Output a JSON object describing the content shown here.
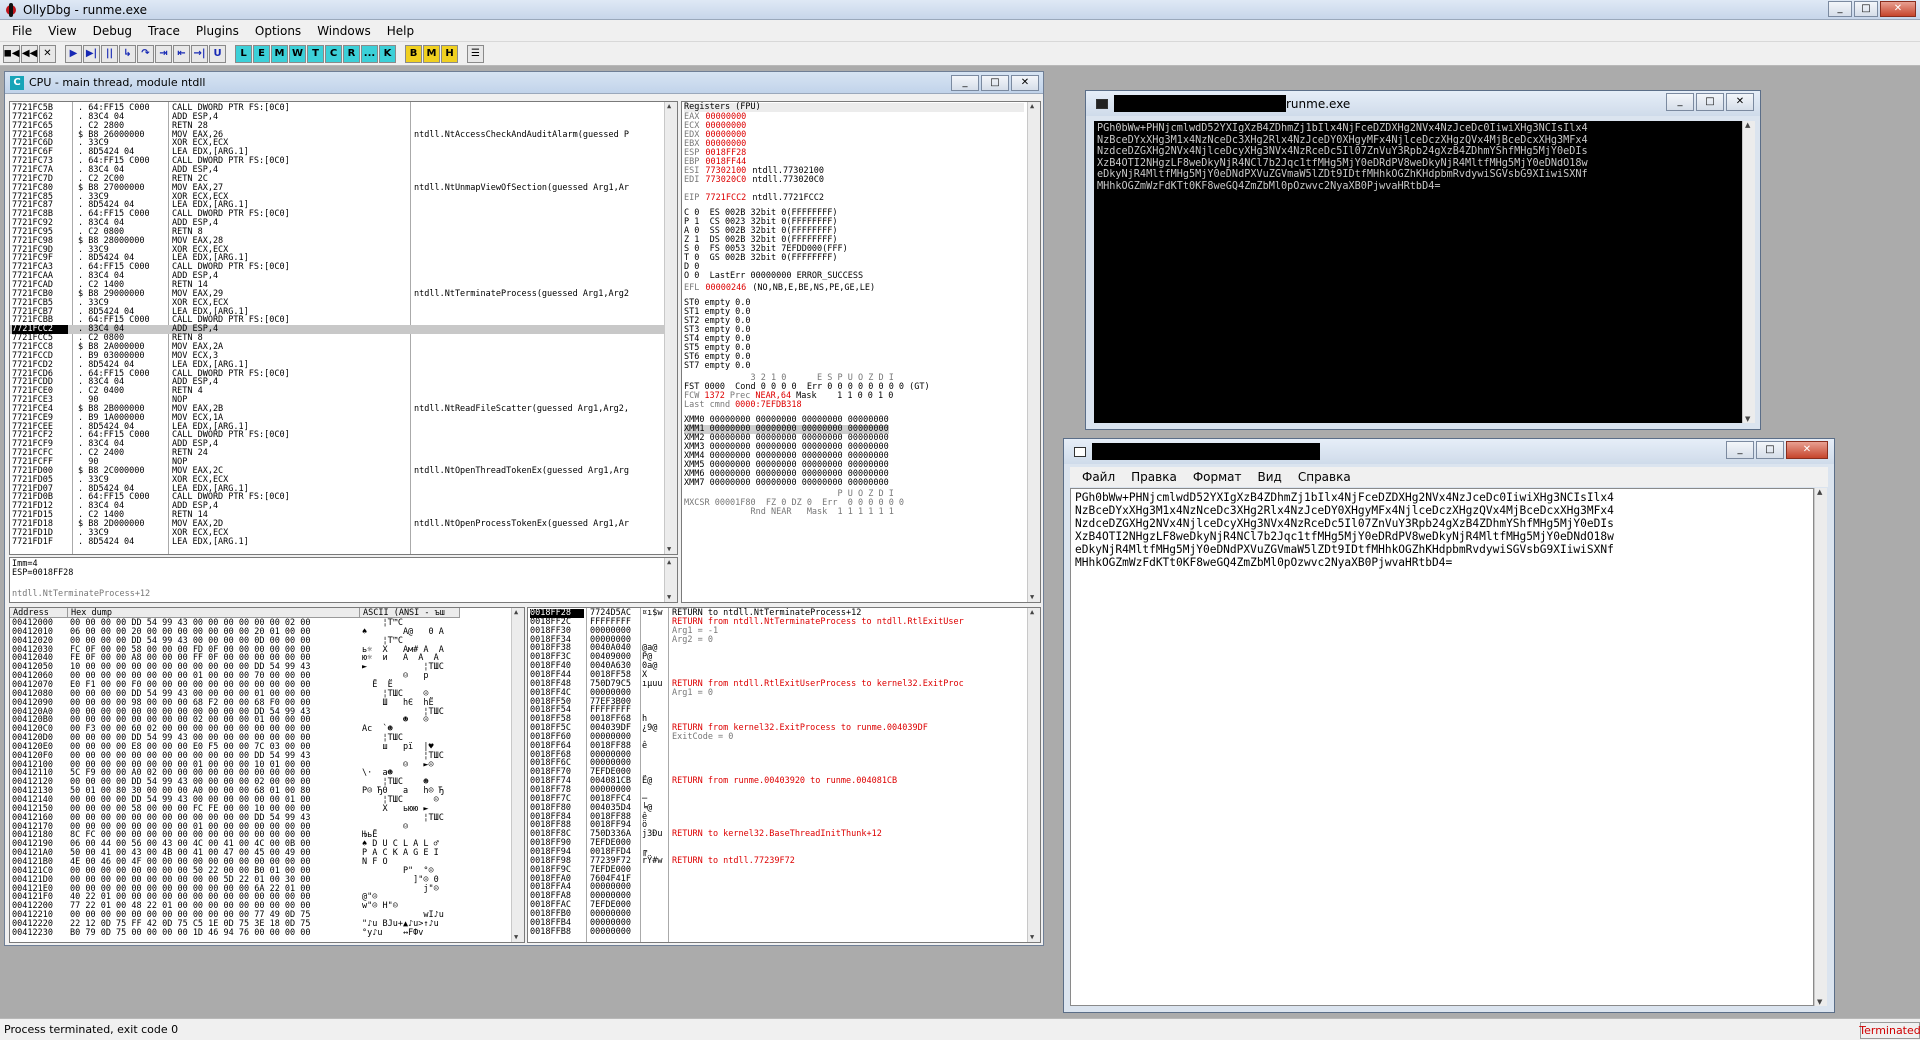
{
  "app": {
    "title": "OllyDbg - runme.exe",
    "minimize_label": "_",
    "maximize_label": "□",
    "close_label": "✕"
  },
  "menu": [
    "File",
    "View",
    "Debug",
    "Trace",
    "Plugins",
    "Options",
    "Windows",
    "Help"
  ],
  "toolbar": {
    "buttons": [
      "◼◀",
      "◀◀",
      "✕",
      "▶",
      "▶|",
      "||",
      "↳",
      "↷",
      "⇥",
      "⇤",
      "→|",
      "U",
      "L",
      "E",
      "M",
      "W",
      "T",
      "C",
      "R",
      "...",
      "K",
      "B",
      "M",
      "H",
      "☰"
    ],
    "styles": [
      "",
      "",
      "",
      "blue",
      "blue",
      "blue",
      "blue",
      "blue",
      "blue",
      "blue",
      "blue",
      "blue",
      "cyan",
      "cyan",
      "cyan",
      "cyan",
      "cyan",
      "cyan",
      "cyan",
      "cyan",
      "cyan",
      "yellow",
      "yellow",
      "yellow",
      ""
    ]
  },
  "cpu": {
    "title": "CPU - main thread, module ntdll",
    "icon_letter": "C",
    "disasm": [
      [
        "7721FC5B",
        ". 64:FF15 C000",
        "CALL DWORD PTR FS:[0C0]",
        ""
      ],
      [
        "7721FC62",
        ". 83C4 04",
        "ADD ESP,4",
        ""
      ],
      [
        "7721FC65",
        ". C2 2800",
        "RETN 28",
        ""
      ],
      [
        "7721FC68",
        "$ B8 26000000",
        "MOV EAX,26",
        "ntdll.NtAccessCheckAndAuditAlarm(guessed P"
      ],
      [
        "7721FC6D",
        ". 33C9",
        "XOR ECX,ECX",
        ""
      ],
      [
        "7721FC6F",
        ". 8D5424 04",
        "LEA EDX,[ARG.1]",
        ""
      ],
      [
        "7721FC73",
        ". 64:FF15 C000",
        "CALL DWORD PTR FS:[0C0]",
        ""
      ],
      [
        "7721FC7A",
        ". 83C4 04",
        "ADD ESP,4",
        ""
      ],
      [
        "7721FC7D",
        ". C2 2C00",
        "RETN 2C",
        ""
      ],
      [
        "7721FC80",
        "$ B8 27000000",
        "MOV EAX,27",
        "ntdll.NtUnmapViewOfSection(guessed Arg1,Ar"
      ],
      [
        "7721FC85",
        ". 33C9",
        "XOR ECX,ECX",
        ""
      ],
      [
        "7721FC87",
        ". 8D5424 04",
        "LEA EDX,[ARG.1]",
        ""
      ],
      [
        "7721FC8B",
        ". 64:FF15 C000",
        "CALL DWORD PTR FS:[0C0]",
        ""
      ],
      [
        "7721FC92",
        ". 83C4 04",
        "ADD ESP,4",
        ""
      ],
      [
        "7721FC95",
        ". C2 0800",
        "RETN 8",
        ""
      ],
      [
        "7721FC98",
        "$ B8 28000000",
        "MOV EAX,28",
        ""
      ],
      [
        "7721FC9D",
        ". 33C9",
        "XOR ECX,ECX",
        ""
      ],
      [
        "7721FC9F",
        ". 8D5424 04",
        "LEA EDX,[ARG.1]",
        ""
      ],
      [
        "7721FCA3",
        ". 64:FF15 C000",
        "CALL DWORD PTR FS:[0C0]",
        ""
      ],
      [
        "7721FCAA",
        ". 83C4 04",
        "ADD ESP,4",
        ""
      ],
      [
        "7721FCAD",
        ". C2 1400",
        "RETN 14",
        ""
      ],
      [
        "7721FCB0",
        "$ B8 29000000",
        "MOV EAX,29",
        "ntdll.NtTerminateProcess(guessed Arg1,Arg2"
      ],
      [
        "7721FCB5",
        ". 33C9",
        "XOR ECX,ECX",
        ""
      ],
      [
        "7721FCB7",
        ". 8D5424 04",
        "LEA EDX,[ARG.1]",
        ""
      ],
      [
        "7721FCBB",
        ". 64:FF15 C000",
        "CALL DWORD PTR FS:[0C0]",
        ""
      ],
      [
        "7721FCC2",
        ". 83C4 04",
        "ADD ESP,4",
        ""
      ],
      [
        "7721FCC5",
        ". C2 0800",
        "RETN 8",
        ""
      ],
      [
        "7721FCC8",
        "$ B8 2A000000",
        "MOV EAX,2A",
        ""
      ],
      [
        "7721FCCD",
        ". B9 03000000",
        "MOV ECX,3",
        ""
      ],
      [
        "7721FCD2",
        ". 8D5424 04",
        "LEA EDX,[ARG.1]",
        ""
      ],
      [
        "7721FCD6",
        ". 64:FF15 C000",
        "CALL DWORD PTR FS:[0C0]",
        ""
      ],
      [
        "7721FCDD",
        ". 83C4 04",
        "ADD ESP,4",
        ""
      ],
      [
        "7721FCE0",
        ". C2 0400",
        "RETN 4",
        ""
      ],
      [
        "7721FCE3",
        "  90",
        "NOP",
        ""
      ],
      [
        "7721FCE4",
        "$ B8 2B000000",
        "MOV EAX,2B",
        "ntdll.NtReadFileScatter(guessed Arg1,Arg2,"
      ],
      [
        "7721FCE9",
        ". B9 1A000000",
        "MOV ECX,1A",
        ""
      ],
      [
        "7721FCEE",
        ". 8D5424 04",
        "LEA EDX,[ARG.1]",
        ""
      ],
      [
        "7721FCF2",
        ". 64:FF15 C000",
        "CALL DWORD PTR FS:[0C0]",
        ""
      ],
      [
        "7721FCF9",
        ". 83C4 04",
        "ADD ESP,4",
        ""
      ],
      [
        "7721FCFC",
        ". C2 2400",
        "RETN 24",
        ""
      ],
      [
        "7721FCFF",
        "  90",
        "NOP",
        ""
      ],
      [
        "7721FD00",
        "$ B8 2C000000",
        "MOV EAX,2C",
        "ntdll.NtOpenThreadTokenEx(guessed Arg1,Arg"
      ],
      [
        "7721FD05",
        ". 33C9",
        "XOR ECX,ECX",
        ""
      ],
      [
        "7721FD07",
        ". 8D5424 04",
        "LEA EDX,[ARG.1]",
        ""
      ],
      [
        "7721FD0B",
        ". 64:FF15 C000",
        "CALL DWORD PTR FS:[0C0]",
        ""
      ],
      [
        "7721FD12",
        ". 83C4 04",
        "ADD ESP,4",
        ""
      ],
      [
        "7721FD15",
        ". C2 1400",
        "RETN 14",
        ""
      ],
      [
        "7721FD18",
        "$ B8 2D000000",
        "MOV EAX,2D",
        "ntdll.NtOpenProcessTokenEx(guessed Arg1,Ar"
      ],
      [
        "7721FD1D",
        ". 33C9",
        "XOR ECX,ECX",
        ""
      ],
      [
        "7721FD1F",
        ". 8D5424 04",
        "LEA EDX,[ARG.1]",
        ""
      ]
    ],
    "selected_row": 25,
    "info": [
      "Imm=4",
      "ESP=0018FF28",
      "",
      "",
      "ntdll.NtTerminateProcess+12"
    ],
    "registers_header": "Registers (FPU)",
    "registers": [
      [
        "EAX",
        "00000000",
        ""
      ],
      [
        "ECX",
        "00000000",
        ""
      ],
      [
        "EDX",
        "00000000",
        ""
      ],
      [
        "EBX",
        "00000000",
        ""
      ],
      [
        "ESP",
        "0018FF28",
        ""
      ],
      [
        "EBP",
        "0018FF44",
        ""
      ],
      [
        "ESI",
        "77302100",
        "ntdll.77302100"
      ],
      [
        "EDI",
        "773020C0",
        "ntdll.773020C0"
      ],
      [
        "",
        "",
        ""
      ],
      [
        "EIP",
        "7721FCC2",
        "ntdll.7721FCC2"
      ]
    ],
    "flags": [
      "C 0  ES 002B 32bit 0(FFFFFFFF)",
      "P 1  CS 0023 32bit 0(FFFFFFFF)",
      "A 0  SS 002B 32bit 0(FFFFFFFF)",
      "Z 1  DS 002B 32bit 0(FFFFFFFF)",
      "S 0  FS 0053 32bit 7EFDD000(FFF)",
      "T 0  GS 002B 32bit 0(FFFFFFFF)",
      "D 0",
      "O 0  LastErr 00000000 ERROR_SUCCESS"
    ],
    "efl": [
      "EFL",
      "00000246",
      "(NO,NB,E,BE,NS,PE,GE,LE)"
    ],
    "fpu_st": [
      "ST0 empty 0.0",
      "ST1 empty 0.0",
      "ST2 empty 0.0",
      "ST3 empty 0.0",
      "ST4 empty 0.0",
      "ST5 empty 0.0",
      "ST6 empty 0.0",
      "ST7 empty 0.0"
    ],
    "fpu_bits": "             3 2 1 0      E S P U O Z D I",
    "fst": "FST 0000  Cond 0 0 0 0  Err 0 0 0 0 0 0 0 0 (GT)",
    "fcw": [
      "FCW",
      "1372",
      "Prec",
      "NEAR,64",
      "Mask    1 1 0 0 1 0"
    ],
    "last_cmnd": [
      "Last cmnd",
      "0000:7EFDB318"
    ],
    "xmm": [
      "XMM0 00000000 00000000 00000000 00000000",
      "XMM1 00000000 00000000 00000000 00000000",
      "XMM2 00000000 00000000 00000000 00000000",
      "XMM3 00000000 00000000 00000000 00000000",
      "XMM4 00000000 00000000 00000000 00000000",
      "XMM5 00000000 00000000 00000000 00000000",
      "XMM6 00000000 00000000 00000000 00000000",
      "XMM7 00000000 00000000 00000000 00000000"
    ],
    "mxcsr": [
      "                              P U O Z D I",
      "MXCSR 00001F80  FZ 0 DZ 0  Err  0 0 0 0 0 0",
      "             Rnd NEAR   Mask  1 1 1 1 1 1"
    ],
    "dump_headers": [
      "Address",
      "Hex dump",
      "ASCII (ANSI - ъш"
    ],
    "dump": [
      [
        "00412000",
        "00 00 00 00 DD 54 99 43 00 00 00 00 00 00 02 00",
        "    ¦T™C      "
      ],
      [
        "00412010",
        "06 00 00 00 20 00 00 00 00 00 00 00 20 01 00 00",
        "♠       A@   0 A"
      ],
      [
        "00412020",
        "00 00 00 00 DD 54 99 43 00 00 00 00 0D 00 00 00",
        "    ¦T™C    "
      ],
      [
        "00412030",
        "FC 0F 00 00 58 00 00 00 FD 0F 00 00 00 00 00 00",
        "ь☼  X   Aм# A  A"
      ],
      [
        "00412040",
        "FE 0F 00 00 A8 00 00 00 FF 0F 00 00 00 00 00 00",
        "ю☼  и   А  A  A"
      ],
      [
        "00412050",
        "10 00 00 00 00 00 00 00 00 00 00 00 DD 54 99 43",
        "►           ¦TШC"
      ],
      [
        "00412060",
        "00 00 00 00 00 00 00 00 01 00 00 00 70 00 00 00",
        "        ☺   p"
      ],
      [
        "00412070",
        "E0 F1 00 00 F0 00 00 00 00 00 00 00 00 00 00 00",
        "  Ё  Ё"
      ],
      [
        "00412080",
        "00 00 00 00 DD 54 99 43 00 00 00 00 01 00 00 00",
        "    ¦TШC    ☺"
      ],
      [
        "00412090",
        "00 00 00 00 98 00 00 00 68 F2 00 00 68 F0 00 00",
        "    Ш   hЄ  hЁ"
      ],
      [
        "004120A0",
        "00 00 00 00 00 00 00 00 00 00 00 00 DD 54 99 43",
        "            ¦TШC"
      ],
      [
        "004120B0",
        "00 00 00 00 00 00 00 00 02 00 00 00 01 00 00 00",
        "        ☻   ☺"
      ],
      [
        "004120C0",
        "00 F3 00 00 60 02 00 00 00 00 00 00 00 00 00 00",
        "Ac  `☻"
      ],
      [
        "004120D0",
        "00 00 00 00 DD 54 99 43 00 00 00 00 00 00 00 00",
        "    ¦TШC"
      ],
      [
        "004120E0",
        "00 00 00 00 E8 00 00 00 E0 F5 00 00 7C 03 00 00",
        "    ш   рї  |♥"
      ],
      [
        "004120F0",
        "00 00 00 00 00 00 00 00 00 00 00 00 DD 54 99 43",
        "            ¦TШC"
      ],
      [
        "00412100",
        "00 00 00 00 00 00 00 00 01 00 00 00 10 01 00 00",
        "        ☺   ►☺"
      ],
      [
        "00412110",
        "5C F9 00 00 A0 02 00 00 00 00 00 00 00 00 00 00",
        "\\·  a☻"
      ],
      [
        "00412120",
        "00 00 00 00 DD 54 99 43 00 00 00 00 02 00 00 00",
        "    ¦TШC    ☻"
      ],
      [
        "00412130",
        "50 01 00 80 30 00 00 00 A0 00 00 00 68 01 00 80",
        "P☺ Ђ0   a   h☺ Ђ"
      ],
      [
        "00412140",
        "00 00 00 00 DD 54 99 43 00 00 00 00 00 00 01 00",
        "    ¦TШC      ☺"
      ],
      [
        "00412150",
        "00 00 00 00 58 00 00 00 FC FE 00 00 10 00 00 00",
        "    X   ьюю ►"
      ],
      [
        "00412160",
        "00 00 00 00 00 00 00 00 00 00 00 00 DD 54 99 43",
        "            ¦TШC"
      ],
      [
        "00412170",
        "00 00 00 00 00 00 00 00 01 00 00 00 00 00 00 00",
        "        ☺"
      ],
      [
        "00412180",
        "8C FC 00 00 00 00 00 00 00 00 00 00 00 00 00 00",
        "ЊьЁ"
      ],
      [
        "00412190",
        "06 00 44 00 56 00 43 00 4C 00 41 00 4C 00 0B 00",
        "♠ D U C L A L ♂"
      ],
      [
        "004121A0",
        "50 00 41 00 43 00 4B 00 41 00 47 00 45 00 49 00",
        "P A C K A G E I"
      ],
      [
        "004121B0",
        "4E 00 46 00 4F 00 00 00 00 00 00 00 00 00 00 00",
        "N F O"
      ],
      [
        "004121C0",
        "00 00 00 00 00 00 00 00 50 22 00 00 B0 01 00 00",
        "        P\"  °☺"
      ],
      [
        "004121D0",
        "00 00 00 00 00 00 00 00 00 00 5D 22 01 00 30 00",
        "          ]\"☺ 0"
      ],
      [
        "004121E0",
        "00 00 00 00 00 00 00 00 00 00 00 00 6A 22 01 00",
        "            j\"☺"
      ],
      [
        "004121F0",
        "40 22 01 00 00 00 00 00 00 00 00 00 00 00 00 00",
        "@\"☺"
      ],
      [
        "00412200",
        "77 22 01 00 48 22 01 00 00 00 00 00 00 00 00 00",
        "w\"☺ H\"☺"
      ],
      [
        "00412210",
        "00 00 00 00 00 00 00 00 00 00 00 00 77 49 0D 75",
        "            wI♪u"
      ],
      [
        "00412220",
        "22 12 0D 75 FF 42 0D 75 C5 1E 0D 75 3E 18 0D 75",
        "\"♪u BJu+▲♪u>↑♪u"
      ],
      [
        "00412230",
        "B0 79 0D 75 00 00 00 00 1D 46 94 76 00 00 00 00",
        "°y♪u    ↔FФv"
      ]
    ],
    "stack": [
      [
        "0018FF28",
        "7724D5AC",
        "¤ı$w",
        "RETURN to ntdll.NtTerminateProcess+12"
      ],
      [
        "0018FF2C",
        "FFFFFFFF",
        "",
        "RETURN from ntdll.NtTerminateProcess to ntdll.RtlExitUser"
      ],
      [
        "0018FF30",
        "00000000",
        "",
        "Arg1 = -1"
      ],
      [
        "0018FF34",
        "00000000",
        "",
        "Arg2 = 0"
      ],
      [
        "0018FF38",
        "0040A040",
        "@a@",
        ""
      ],
      [
        "0018FF3C",
        "00409000",
        "P@",
        ""
      ],
      [
        "0018FF40",
        "0040A630",
        "0a@",
        ""
      ],
      [
        "0018FF44",
        "0018FF58",
        "X ",
        ""
      ],
      [
        "0018FF48",
        "750D79C5",
        "ıµuu",
        "RETURN from ntdll.RtlExitUserProcess to kernel32.ExitProc"
      ],
      [
        "0018FF4C",
        "00000000",
        "",
        "Arg1 = 0"
      ],
      [
        "0018FF50",
        "77EF3B00",
        "",
        ""
      ],
      [
        "0018FF54",
        "FFFFFFFF",
        "",
        ""
      ],
      [
        "0018FF58",
        "0018FF68",
        "h ",
        ""
      ],
      [
        "0018FF5C",
        "004039DF",
        "¿9@",
        "RETURN from kernel32.ExitProcess to runme.004039DF"
      ],
      [
        "0018FF60",
        "00000000",
        "",
        "ExitCode = 0"
      ],
      [
        "0018FF64",
        "0018FF88",
        "ê ",
        ""
      ],
      [
        "0018FF68",
        "00000000",
        "",
        ""
      ],
      [
        "0018FF6C",
        "00000000",
        "",
        ""
      ],
      [
        "0018FF70",
        "7EFDE000",
        "",
        ""
      ],
      [
        "0018FF74",
        "004081CB",
        "Ё@",
        "RETURN from runme.00403920 to runme.004081CB"
      ],
      [
        "0018FF78",
        "00000000",
        "",
        ""
      ],
      [
        "0018FF7C",
        "0018FFC4",
        "─ ",
        ""
      ],
      [
        "0018FF80",
        "004035D4",
        "╘@",
        ""
      ],
      [
        "0018FF84",
        "0018FF88",
        "ê ",
        ""
      ],
      [
        "0018FF88",
        "0018FF94",
        "ö ",
        ""
      ],
      [
        "0018FF8C",
        "750D336A",
        "j3Đu",
        "RETURN to kernel32.BaseThreadInitThunk+12"
      ],
      [
        "0018FF90",
        "7EFDE000",
        "",
        ""
      ],
      [
        "0018FF94",
        "0018FFD4",
        "╔ ",
        ""
      ],
      [
        "0018FF98",
        "77239F72",
        "rŸ#w",
        "RETURN to ntdll.77239F72"
      ],
      [
        "0018FF9C",
        "7EFDE000",
        "",
        ""
      ],
      [
        "0018FFA0",
        "7604F41F",
        "",
        ""
      ],
      [
        "0018FFA4",
        "00000000",
        "",
        ""
      ],
      [
        "0018FFA8",
        "00000000",
        "",
        ""
      ],
      [
        "0018FFAC",
        "7EFDE000",
        "",
        ""
      ],
      [
        "0018FFB0",
        "00000000",
        "",
        ""
      ],
      [
        "0018FFB4",
        "00000000",
        "",
        ""
      ],
      [
        "0018FFB8",
        "00000000",
        "",
        ""
      ]
    ]
  },
  "console": {
    "title": "runme.exe",
    "text": "PGh0bWw+PHNjcmlwdD52YXIgXzB4ZDhmZj1bIlx4NjFceDZDXHg2NVx4NzJceDc0IiwiXHg3NCIsIlx4\nNzBceDYxXHg3M1x4NzNceDc3XHg2Rlx4NzJceDY0XHgyMFx4NjlceDczXHgzQVx4MjBceDcxXHg3MFx4\nNzdceDZGXHg2NVx4NjlceDcyXHg3NVx4NzRceDc5Il07ZnVuY3Rpb24gXzB4ZDhmYShfMHg5MjY0eDIs\nXzB4OTI2NHgzLF8weDkyNjR4NCl7b2Jqc1tfMHg5MjY0eDRdPV8weDkyNjR4MltfMHg5MjY0eDNdO18w\neDkyNjR4MltfMHg5MjY0eDNdPXVuZGVmaW5lZDt9IDtfMHhkOGZhKHdpbmRvdywiSGVsbG9XIiwiSXNf\nMHhkOGZmWzFdKTt0KF8weGQ4ZmZbMl0pOzwvc2NyaXB0PjwvaHRtbD4="
  },
  "notepad": {
    "menu": [
      "Файл",
      "Правка",
      "Формат",
      "Вид",
      "Справка"
    ],
    "text": "PGh0bWw+PHNjcmlwdD52YXIgXzB4ZDhmZj1bIlx4NjFceDZDXHg2NVx4NzJceDc0IiwiXHg3NCIsIlx4\nNzBceDYxXHg3M1x4NzNceDc3XHg2Rlx4NzJceDY0XHgyMFx4NjlceDczXHgzQVx4MjBceDcxXHg3MFx4\nNzdceDZGXHg2NVx4NjlceDcyXHg3NVx4NzRceDc5Il07ZnVuY3Rpb24gXzB4ZDhmYShfMHg5MjY0eDIs\nXzB4OTI2NHgzLF8weDkyNjR4NCl7b2Jqc1tfMHg5MjY0eDRdPV8weDkyNjR4MltfMHg5MjY0eDNdO18w\neDkyNjR4MltfMHg5MjY0eDNdPXVuZGVmaW5lZDt9IDtfMHhkOGZhKHdpbmRvdywiSGVsbG9XIiwiSXNf\nMHhkOGZmWzFdKTt0KF8weGQ4ZmZbMl0pOzwvc2NyaXB0PjwvaHRtbD4="
  },
  "status": {
    "text": "Process terminated, exit code 0",
    "badge": "Terminated"
  },
  "colors": {
    "accent_red": "#d00000",
    "selection_gray": "#c8c8c8"
  }
}
